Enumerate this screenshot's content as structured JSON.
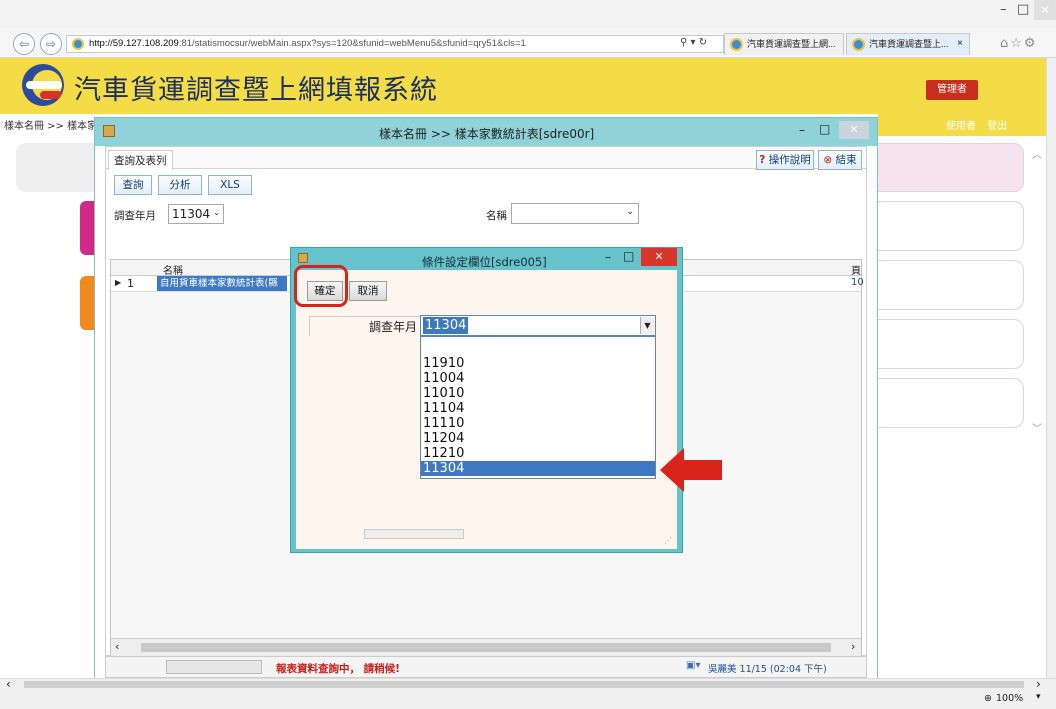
{
  "browser": {
    "url_host": "http://59.127.108.209",
    "url_rest": ":81/statismocsur/webMain.aspx?sys=120&sfunid=webMenu5&sfunid=qry51&cls=1",
    "search_glyph": "⚲ ▾ ↻",
    "tabs": [
      {
        "label": "汽車貨運調查暨上網...",
        "active": false
      },
      {
        "label": "汽車貨運調查暨上...",
        "active": true
      }
    ],
    "zoom": "100%",
    "close_tab": "×"
  },
  "app": {
    "title": "汽車貨運調查暨上網填報系統",
    "admin_badge": "管理者",
    "breadcrumb": "樣本名冊 >> 樣本家數統計表",
    "user_links": [
      "使用者",
      "登出"
    ]
  },
  "main_window": {
    "title": "樣本名冊 >> 樣本家數統計表[sdre00r]",
    "tab_label": "查詢及表列",
    "help_label": "操作說明",
    "close_label": "結束",
    "toolbar": {
      "query": "查詢",
      "analyze": "分析",
      "xls": "XLS"
    },
    "filters": {
      "year_label": "調查年月",
      "year_value": "11304",
      "name_label": "名稱",
      "name_value": ""
    },
    "grid": {
      "columns": [
        "名稱",
        "頁"
      ],
      "rows": [
        {
          "index": "1",
          "name": "自用貨車樣本家數統計表(縣",
          "extra": "10"
        }
      ]
    },
    "status_message": "報表資料查詢中， 請稍候!",
    "user_info": "吳麗美  11/15 (02:04 下午)"
  },
  "dialog": {
    "title": "條件設定欄位[sdre005]",
    "confirm_label": "確定",
    "cancel_label": "取消",
    "field_label": "調查年月",
    "selected_value": "11304",
    "options": [
      "",
      "11910",
      "11004",
      "11010",
      "11104",
      "11110",
      "11204",
      "11210",
      "11304"
    ]
  },
  "colors": {
    "header_yellow": "#f4dc46",
    "window_teal": "#8fd2d8",
    "highlight_red": "#d9241c",
    "selection_blue": "#3f79c1"
  }
}
